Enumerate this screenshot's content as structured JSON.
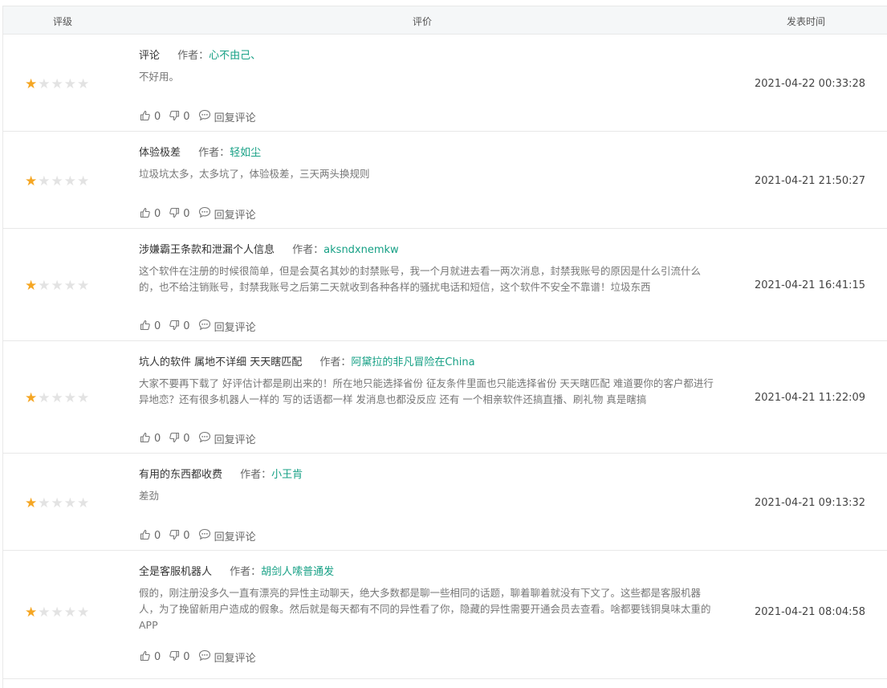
{
  "header": {
    "rating": "评级",
    "review": "评价",
    "time": "发表时间"
  },
  "labels": {
    "author_prefix": "作者：",
    "reply": "回复评论"
  },
  "colors": {
    "star_on": "#f5a623",
    "star_off": "#e3e3e3",
    "author": "#16a085",
    "header_bg": "#f5f7f8"
  },
  "reviews": [
    {
      "title": "评论",
      "author": "心不由己、",
      "content": "不好用。",
      "likes": "0",
      "dislikes": "0",
      "time": "2021-04-22 00:33:28",
      "rating": 1
    },
    {
      "title": "体验极差",
      "author": "轻如尘",
      "content": "垃圾坑太多，太多坑了，体验极差，三天两头换规则",
      "likes": "0",
      "dislikes": "0",
      "time": "2021-04-21 21:50:27",
      "rating": 1
    },
    {
      "title": "涉嫌霸王条款和泄漏个人信息",
      "author": "aksndxnemkw",
      "content": "这个软件在注册的时候很简单，但是会莫名其妙的封禁账号，我一个月就进去看一两次消息，封禁我账号的原因是什么引流什么的，也不给注销账号，封禁我账号之后第二天就收到各种各样的骚扰电话和短信，这个软件不安全不靠谱！垃圾东西",
      "likes": "0",
      "dislikes": "0",
      "time": "2021-04-21 16:41:15",
      "rating": 1
    },
    {
      "title": "坑人的软件 属地不详细 天天瞎匹配",
      "author": "阿黛拉的非凡冒险在China",
      "content": "大家不要再下载了 好评估计都是刷出来的！所在地只能选择省份 征友条件里面也只能选择省份 天天瞎匹配 难道要你的客户都进行异地恋？还有很多机器人一样的 写的话语都一样 发消息也都没反应 还有 一个相亲软件还搞直播、刷礼物 真是瞎搞",
      "likes": "0",
      "dislikes": "0",
      "time": "2021-04-21 11:22:09",
      "rating": 1
    },
    {
      "title": "有用的东西都收费",
      "author": "小王肯",
      "content": "差劲",
      "likes": "0",
      "dislikes": "0",
      "time": "2021-04-21 09:13:32",
      "rating": 1
    },
    {
      "title": "全是客服机器人",
      "author": "胡剑人嗦普通发",
      "content": "假的，刚注册没多久一直有漂亮的异性主动聊天，绝大多数都是聊一些相同的话题，聊着聊着就没有下文了。这些都是客服机器人，为了挽留新用户造成的假象。然后就是每天都有不同的异性看了你，隐藏的异性需要开通会员去查看。啥都要钱铜臭味太重的APP",
      "likes": "0",
      "dislikes": "0",
      "time": "2021-04-21 08:04:58",
      "rating": 1
    }
  ]
}
